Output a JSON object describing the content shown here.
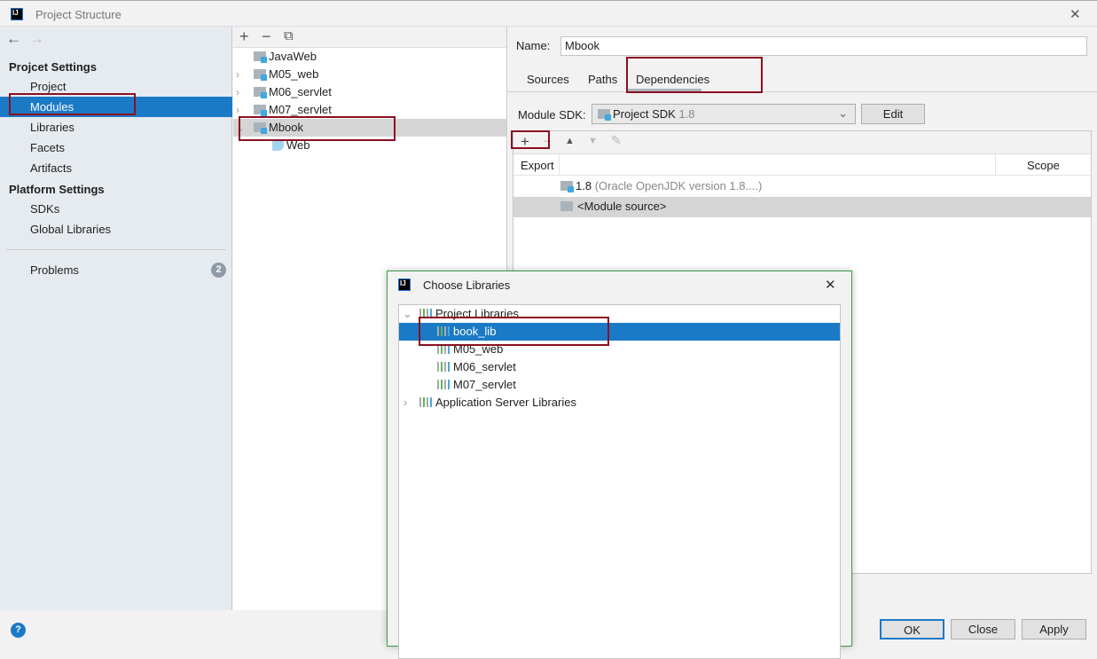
{
  "window": {
    "title": "Project Structure",
    "close": "✕"
  },
  "sidebar": {
    "back": "←",
    "forward": "→",
    "project_settings": "Projcet Settings",
    "platform_settings": "Platform Settings",
    "items": [
      {
        "label": "Project"
      },
      {
        "label": "Modules",
        "selected": true
      },
      {
        "label": "Libraries"
      },
      {
        "label": "Facets"
      },
      {
        "label": "Artifacts"
      }
    ],
    "platform_items": [
      {
        "label": "SDKs"
      },
      {
        "label": "Global Libraries"
      }
    ],
    "problems": {
      "label": "Problems",
      "count": "2"
    }
  },
  "modules": {
    "toolbar": {
      "add": "+",
      "remove": "−",
      "copy": "⧉"
    },
    "items": [
      {
        "label": "JavaWeb",
        "chevron": ""
      },
      {
        "label": "M05_web",
        "chevron": "›"
      },
      {
        "label": "M06_servlet",
        "chevron": "›"
      },
      {
        "label": "M07_servlet",
        "chevron": "›"
      },
      {
        "label": "Mbook",
        "chevron": "⌄",
        "selected": true
      }
    ],
    "child": "Web"
  },
  "details": {
    "name_label": "Name:",
    "name_value": "Mbook",
    "tabs": [
      {
        "label": "Sources"
      },
      {
        "label": "Paths"
      },
      {
        "label": "Dependencies",
        "active": true
      }
    ],
    "sdk_label": "Module SDK:",
    "sdk_value": "Project SDK",
    "sdk_version": "1.8",
    "edit": "Edit",
    "toolbar": {
      "add": "+",
      "remove": "−",
      "up": "▲",
      "down": "▼",
      "edit": "✎"
    },
    "columns": {
      "export": "Export",
      "scope": "Scope"
    },
    "rows": [
      {
        "name": "1.8",
        "detail": "(Oracle OpenJDK version 1.8....)"
      },
      {
        "name": "<Module source>",
        "selected": true
      }
    ]
  },
  "buttons": {
    "ok": "OK",
    "close": "Close",
    "apply": "Apply",
    "help": "?"
  },
  "dialog": {
    "title": "Choose Libraries",
    "close": "✕",
    "group1": "Project Libraries",
    "libs": [
      {
        "label": "book_lib",
        "selected": true
      },
      {
        "label": "M05_web"
      },
      {
        "label": "M06_servlet"
      },
      {
        "label": "M07_servlet"
      }
    ],
    "group2": "Application Server Libraries"
  },
  "colors": {
    "accent": "#1b7ac6",
    "highlight": "#8b1020",
    "dialog_border": "#3c9a4a"
  }
}
